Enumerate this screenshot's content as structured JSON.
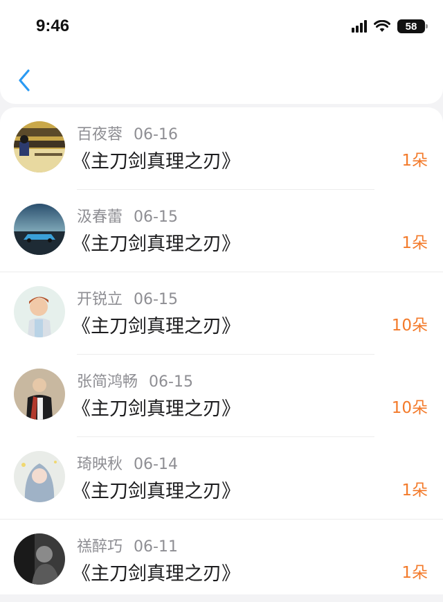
{
  "status_bar": {
    "time": "9:46",
    "battery": "58"
  },
  "header": {
    "back_icon": "chevron-left-icon",
    "accent": "#2a9af3"
  },
  "colors": {
    "name": "#8e8e93",
    "count": "#f37a2a",
    "title": "#1c1c1e"
  },
  "items": [
    {
      "name": "百夜蓉",
      "date": "06-16",
      "title": "《主刀剑真理之刃》",
      "count": "1朵"
    },
    {
      "name": "汲春蕾",
      "date": "06-15",
      "title": "《主刀剑真理之刃》",
      "count": "1朵"
    },
    {
      "name": "开锐立",
      "date": "06-15",
      "title": "《主刀剑真理之刃》",
      "count": "10朵"
    },
    {
      "name": "张简鸿畅",
      "date": "06-15",
      "title": "《主刀剑真理之刃》",
      "count": "10朵"
    },
    {
      "name": "琦映秋",
      "date": "06-14",
      "title": "《主刀剑真理之刃》",
      "count": "1朵"
    },
    {
      "name": "禚醉巧",
      "date": "06-11",
      "title": "《主刀剑真理之刃》",
      "count": "1朵"
    }
  ]
}
